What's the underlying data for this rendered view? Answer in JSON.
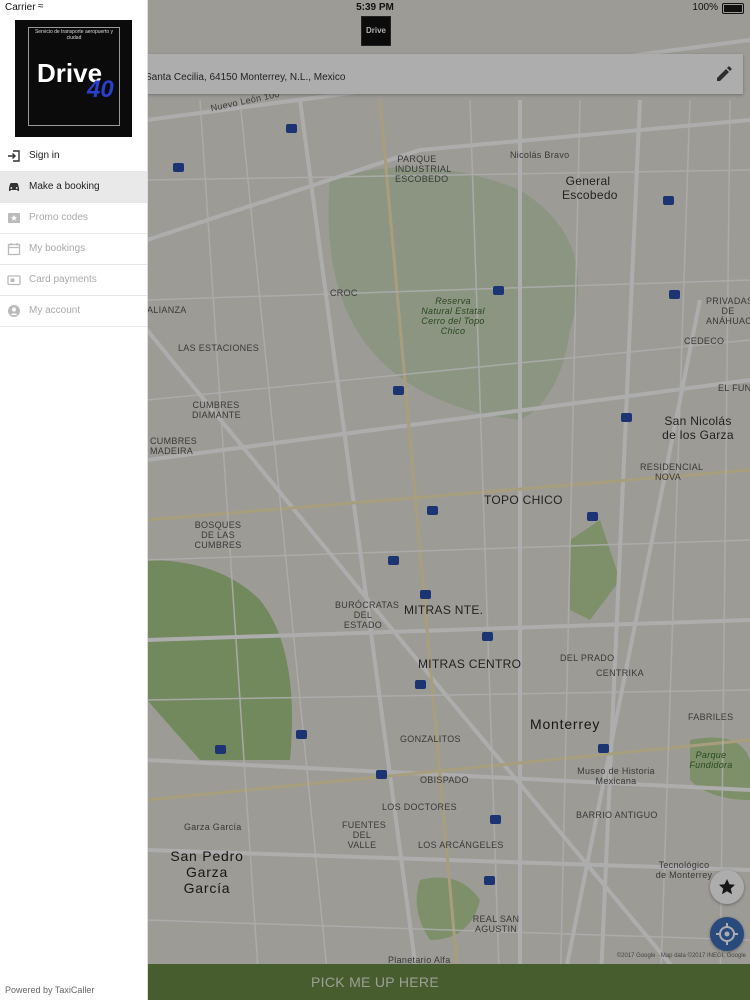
{
  "status_bar": {
    "carrier": "Carrier",
    "time": "5:39 PM",
    "battery": "100%"
  },
  "header": {
    "logo_text": "Drive"
  },
  "address_bar": {
    "address": "Santa Cecilia, 64150 Monterrey, N.L., Mexico",
    "edit_icon": "pencil-icon"
  },
  "drawer": {
    "logo": {
      "tagline": "Servicio de transporte aeropuerto y ciudad",
      "brand": "Drive",
      "brand_num": "40"
    },
    "items": [
      {
        "label": "Sign in",
        "icon": "sign-in-icon",
        "state": "enabled"
      },
      {
        "label": "Make a booking",
        "icon": "car-icon",
        "state": "active"
      },
      {
        "label": "Promo codes",
        "icon": "star-icon",
        "state": "disabled"
      },
      {
        "label": "My bookings",
        "icon": "calendar-icon",
        "state": "disabled"
      },
      {
        "label": "Card payments",
        "icon": "card-icon",
        "state": "disabled"
      },
      {
        "label": "My account",
        "icon": "account-icon",
        "state": "disabled"
      }
    ],
    "footer": "Powered by TaxiCaller"
  },
  "map": {
    "labels": {
      "nuevo_leon": "Nuevo León 100",
      "parque": "PARQUE INDUSTRIAL ESCOBEDO",
      "general": "General Escobedo",
      "nicolas_bravo": "Nicolás Bravo",
      "alianza": "ALIANZA",
      "croc": "CROC",
      "reserva": "Reserva Natural Estatal Cerro del Topo Chico",
      "privadas": "PRIVADAS DE ANÁHUAC",
      "estaciones": "LAS ESTACIONES",
      "cedeco": "CEDECO",
      "el_fune": "EL FUNE",
      "cumbres_diamante": "CUMBRES DIAMANTE",
      "san_nicolas": "San Nicolás de los Garza",
      "cumbres_madeira": "CUMBRES MADEIRA",
      "residencial_nova": "RESIDENCIAL NOVA",
      "topo_chico": "TOPO CHICO",
      "bosques": "BOSQUES DE LAS CUMBRES",
      "burocratas": "BURÓCRATAS DEL ESTADO",
      "mitras_nte": "MITRAS NTE.",
      "mitras_centro": "MITRAS CENTRO",
      "del_prado": "DEL PRADO",
      "centrika": "CENTRIKA",
      "fabriles": "FABRILES",
      "monterrey": "Monterrey",
      "gonzalitos": "GONZALITOS",
      "parque_fundidora": "Parque Fundidora",
      "museo": "Museo de Historia Mexicana",
      "obispado": "OBISPADO",
      "los_doctores": "LOS DOCTORES",
      "barrio_antiguo": "BARRIO ANTIGUO",
      "garza_garcia": "Garza García",
      "fuentes": "FUENTES DEL VALLE",
      "san_pedro": "San Pedro Garza García",
      "arcangeles": "LOS ARCÁNGELES",
      "tec": "Tecnológico de Monterrey",
      "real_san_agustin": "REAL SAN AGUSTIN",
      "planetario": "Planetario Alfa"
    },
    "attribution": "©2017 Google · Map data ©2017 INEGI, Google"
  },
  "actions": {
    "pickup_label": "PICK ME UP HERE",
    "favorites_icon": "star-icon",
    "locate_icon": "crosshair-icon"
  }
}
